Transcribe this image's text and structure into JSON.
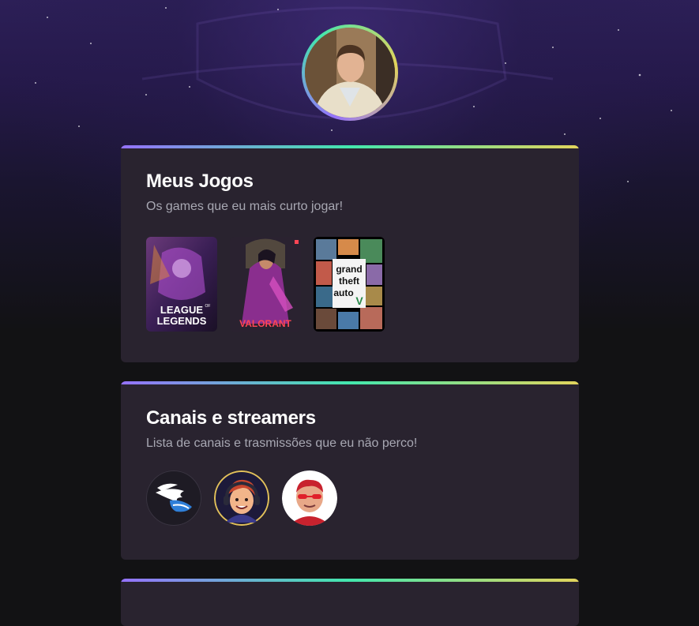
{
  "profile": {
    "avatar_icon": "profile-photo"
  },
  "games_section": {
    "title": "Meus Jogos",
    "subtitle": "Os games que eu mais curto jogar!",
    "games": [
      {
        "logo_line1": "LEAGUE",
        "logo_of": "OF",
        "logo_line2": "LEGENDS"
      },
      {
        "logo": "VALORANT"
      },
      {
        "logo_line1": "grand",
        "logo_line2": "theft",
        "logo_line3": "auto",
        "logo_v": "V"
      }
    ]
  },
  "channels_section": {
    "title": "Canais e streamers",
    "subtitle": "Lista de canais e trasmissões que eu não perco!",
    "channels": [
      {
        "icon": "wing-logo-icon"
      },
      {
        "icon": "cartoon-streamer-avatar"
      },
      {
        "icon": "streamer-red-glasses-avatar"
      }
    ]
  },
  "colors": {
    "accent_purple": "#9572fc",
    "accent_green": "#43e7ad",
    "accent_yellow": "#e2d45c",
    "card_bg": "#29232f"
  }
}
